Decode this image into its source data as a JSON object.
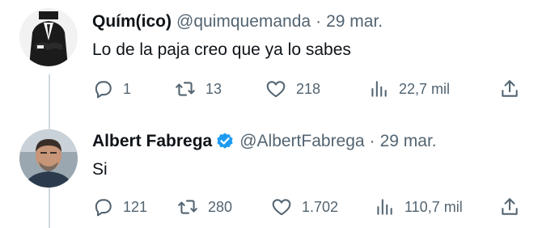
{
  "tweets": [
    {
      "display_name": "Quím(ico)",
      "handle": "@quimquemanda",
      "separator": "·",
      "date": "29 mar.",
      "verified": false,
      "text": "Lo de la paja creo que ya lo sabes",
      "replies": "1",
      "retweets": "13",
      "likes": "218",
      "views": "22,7 mil",
      "avatar_icon": "suit-person-avatar"
    },
    {
      "display_name": "Albert Fabrega",
      "handle": "@AlbertFabrega",
      "separator": "·",
      "date": "29 mar.",
      "verified": true,
      "text": "Si",
      "replies": "121",
      "retweets": "280",
      "likes": "1.702",
      "views": "110,7 mil",
      "avatar_icon": "man-portrait-avatar"
    }
  ],
  "colors": {
    "text": "#0f1419",
    "muted": "#536471",
    "thread_line": "#cfd9de",
    "verified_badge": "#1d9bf0"
  }
}
